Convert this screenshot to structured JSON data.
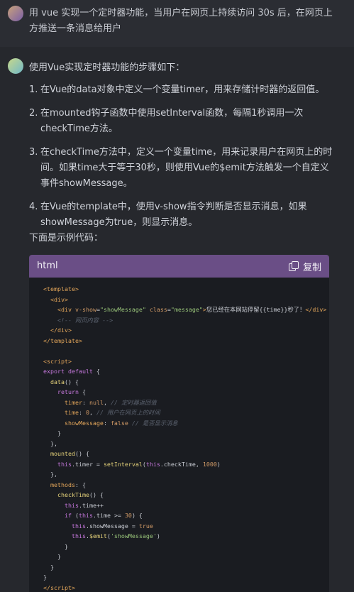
{
  "user_message": {
    "text": "用 vue 实现一个定时器功能，当用户在网页上持续访问 30s 后，在网页上方推送一条消息给用户"
  },
  "assistant": {
    "intro": "使用Vue实现定时器功能的步骤如下：",
    "steps": [
      {
        "num": "1.",
        "text": "在Vue的data对象中定义一个变量timer，用来存储计时器的返回值。"
      },
      {
        "num": "2.",
        "text": "在mounted钩子函数中使用setInterval函数，每隔1秒调用一次checkTime方法。"
      },
      {
        "num": "3.",
        "text": "在checkTime方法中，定义一个变量time，用来记录用户在网页上的时间。如果time大于等于30秒，则使用Vue的$emit方法触发一个自定义事件showMessage。"
      },
      {
        "num": "4.",
        "text": "在Vue的template中，使用v-show指令判断是否显示消息，如果showMessage为true，则显示消息。"
      }
    ],
    "code_intro": "下面是示例代码：",
    "code_block": {
      "language": "html",
      "copy_label": "复制"
    }
  }
}
